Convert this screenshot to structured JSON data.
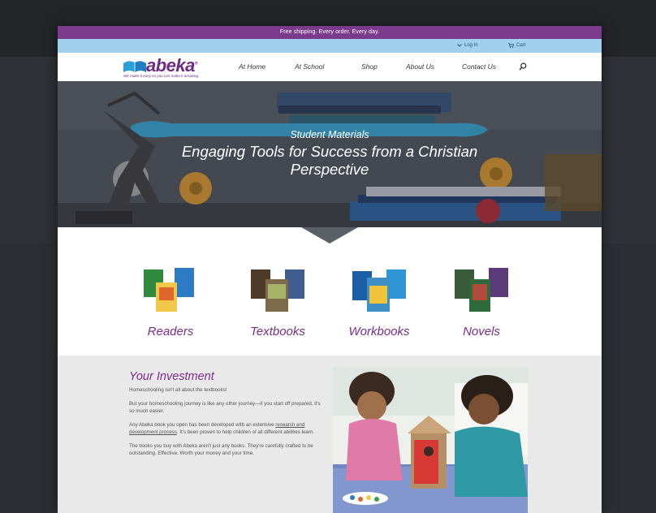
{
  "colors": {
    "brand_purple": "#7b2c8e",
    "promo_bar": "#7c3a8c",
    "utility_bar": "#9fd0ee",
    "section_grey": "#e9e9e9"
  },
  "promo": {
    "text": "Free shipping. Every order. Every day."
  },
  "utility": {
    "login": "Log In",
    "login_icon": "chevron-down-icon",
    "cart": "Cart",
    "cart_icon": "cart-icon"
  },
  "logo": {
    "name": "abeka",
    "mark": "®",
    "tagline": "We make it easy so you can make it amazing."
  },
  "nav": {
    "items": [
      "At Home",
      "At School",
      "Shop",
      "About Us",
      "Contact Us"
    ],
    "search_icon": "search-icon"
  },
  "hero": {
    "subtitle": "Student Materials",
    "headline": "Engaging Tools for Success from a Christian Perspective",
    "book_spines": [
      "The History of Our United States",
      "Language A"
    ]
  },
  "categories": [
    "Readers",
    "Textbooks",
    "Workbooks",
    "Novels"
  ],
  "investment": {
    "title": "Your Investment",
    "p1": "Homeschooling isn't all about the textbooks!",
    "p2": "But your homeschooling journey is like any other journey—if you start off prepared, it's so much easier.",
    "p3_before": "Any Abeka book you open has been developed with an extensive ",
    "p3_link": "research and development process",
    "p3_after": ". It's been proven to help children of all different abilities learn.",
    "p4": "The books you buy with Abeka aren't just any books. They're carefully crafted to be outstanding. Effective. Worth your money and your time."
  }
}
